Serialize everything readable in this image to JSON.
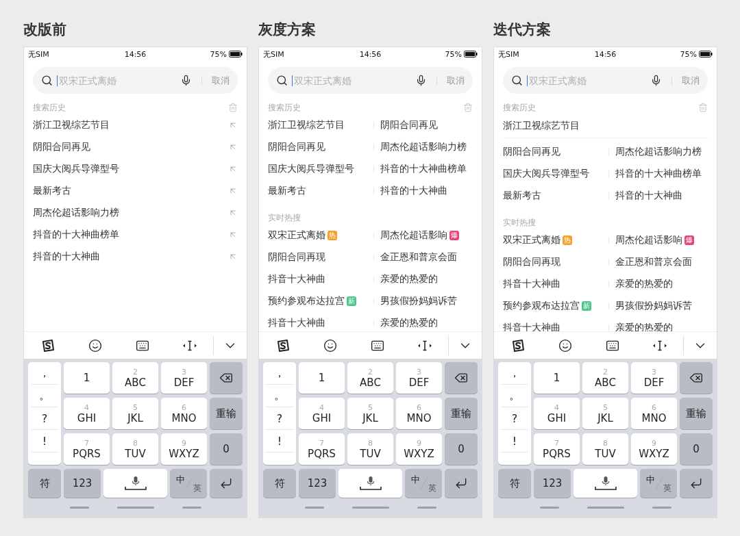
{
  "panels": [
    {
      "title": "改版前",
      "status": {
        "carrier": "无SIM",
        "time": "14:56",
        "battery": "75%"
      },
      "search": {
        "placeholder": "双宋正式离婚",
        "cancel": "取消"
      },
      "history": {
        "label": "搜索历史",
        "kind": "list",
        "items": [
          "浙江卫视综艺节目",
          "阴阳合同再见",
          "国庆大阅兵导弹型号",
          "最新考古",
          "周杰伦超话影响力榜",
          "抖音的十大神曲榜单",
          "抖音的十大神曲"
        ]
      },
      "keyboard": {
        "symbols": [
          "，",
          "。",
          "?",
          "!"
        ],
        "keys": [
          {
            "main": "1"
          },
          {
            "hint": "2",
            "main": "ABC"
          },
          {
            "hint": "3",
            "main": "DEF"
          },
          {
            "hint": "4",
            "main": "GHI"
          },
          {
            "hint": "5",
            "main": "JKL"
          },
          {
            "hint": "6",
            "main": "MNO"
          },
          {
            "hint": "7",
            "main": "PQRS"
          },
          {
            "hint": "8",
            "main": "TUV"
          },
          {
            "hint": "9",
            "main": "WXYZ"
          }
        ],
        "side": [
          {
            "kind": "backspace"
          },
          {
            "kind": "text",
            "label": "重输"
          },
          {
            "kind": "text",
            "label": "0"
          }
        ],
        "bottom": {
          "symbol": "符",
          "number": "123",
          "lang_primary": "中",
          "lang_secondary": "英"
        }
      }
    },
    {
      "title": "灰度方案",
      "status": {
        "carrier": "无SIM",
        "time": "14:56",
        "battery": "75%"
      },
      "search": {
        "placeholder": "双宋正式离婚",
        "cancel": "取消"
      },
      "history": {
        "label": "搜索历史",
        "kind": "grid",
        "items": [
          "浙江卫视综艺节目",
          "阴阳合同再见",
          "阴阳合同再见",
          "周杰伦超话影响力榜",
          "国庆大阅兵导弹型号",
          "抖音的十大神曲榜单",
          "最新考古",
          "抖音的十大神曲"
        ]
      },
      "hot": {
        "label": "实时热搜",
        "items": [
          {
            "text": "双宋正式离婚",
            "badge": {
              "text": "热",
              "color": "#f5a02a"
            }
          },
          {
            "text": "周杰伦超话影响",
            "badge": {
              "text": "爆",
              "color": "#e8437b"
            }
          },
          {
            "text": "阴阳合同再现"
          },
          {
            "text": "金正恩和普京会面"
          },
          {
            "text": "抖音十大神曲"
          },
          {
            "text": "亲爱的热爱的"
          },
          {
            "text": "预约参观布达拉宫",
            "badge": {
              "text": "新",
              "color": "#4dc48a"
            }
          },
          {
            "text": "男孩假扮妈妈诉苦"
          },
          {
            "text": "抖音十大神曲"
          },
          {
            "text": "亲爱的热爱的"
          }
        ]
      },
      "keyboard": {
        "symbols": [
          "，",
          "。",
          "?",
          "!"
        ],
        "keys": [
          {
            "main": "1"
          },
          {
            "hint": "2",
            "main": "ABC"
          },
          {
            "hint": "3",
            "main": "DEF"
          },
          {
            "hint": "4",
            "main": "GHI"
          },
          {
            "hint": "5",
            "main": "JKL"
          },
          {
            "hint": "6",
            "main": "MNO"
          },
          {
            "hint": "7",
            "main": "PQRS"
          },
          {
            "hint": "8",
            "main": "TUV"
          },
          {
            "hint": "9",
            "main": "WXYZ"
          }
        ],
        "side": [
          {
            "kind": "backspace"
          },
          {
            "kind": "text",
            "label": "重输"
          },
          {
            "kind": "text",
            "label": "0"
          }
        ],
        "bottom": {
          "symbol": "符",
          "number": "123",
          "lang_primary": "中",
          "lang_secondary": "英"
        }
      }
    },
    {
      "title": "迭代方案",
      "status": {
        "carrier": "无SIM",
        "time": "14:56",
        "battery": "75%"
      },
      "search": {
        "placeholder": "双宋正式离婚",
        "cancel": "取消"
      },
      "history": {
        "label": "搜索历史",
        "kind": "featured",
        "items": [
          "浙江卫视综艺节目",
          "阴阳合同再见",
          "周杰伦超话影响力榜",
          "国庆大阅兵导弹型号",
          "抖音的十大神曲榜单",
          "最新考古",
          "抖音的十大神曲"
        ]
      },
      "hot": {
        "label": "实时热搜",
        "items": [
          {
            "text": "双宋正式离婚",
            "badge": {
              "text": "热",
              "color": "#f5a02a"
            }
          },
          {
            "text": "周杰伦超话影响",
            "badge": {
              "text": "爆",
              "color": "#e8437b"
            }
          },
          {
            "text": "阴阳合同再现"
          },
          {
            "text": "金正恩和普京会面"
          },
          {
            "text": "抖音十大神曲"
          },
          {
            "text": "亲爱的热爱的"
          },
          {
            "text": "预约参观布达拉宫",
            "badge": {
              "text": "新",
              "color": "#4dc48a"
            }
          },
          {
            "text": "男孩假扮妈妈诉苦"
          },
          {
            "text": "抖音十大神曲"
          },
          {
            "text": "亲爱的热爱的"
          }
        ]
      },
      "keyboard": {
        "symbols": [
          "，",
          "。",
          "?",
          "!"
        ],
        "keys": [
          {
            "main": "1"
          },
          {
            "hint": "2",
            "main": "ABC"
          },
          {
            "hint": "3",
            "main": "DEF"
          },
          {
            "hint": "4",
            "main": "GHI"
          },
          {
            "hint": "5",
            "main": "JKL"
          },
          {
            "hint": "6",
            "main": "MNO"
          },
          {
            "hint": "7",
            "main": "PQRS"
          },
          {
            "hint": "8",
            "main": "TUV"
          },
          {
            "hint": "9",
            "main": "WXYZ"
          }
        ],
        "side": [
          {
            "kind": "backspace"
          },
          {
            "kind": "text",
            "label": "重输"
          },
          {
            "kind": "text",
            "label": "0"
          }
        ],
        "bottom": {
          "symbol": "符",
          "number": "123",
          "lang_primary": "中",
          "lang_secondary": "英"
        }
      }
    }
  ]
}
